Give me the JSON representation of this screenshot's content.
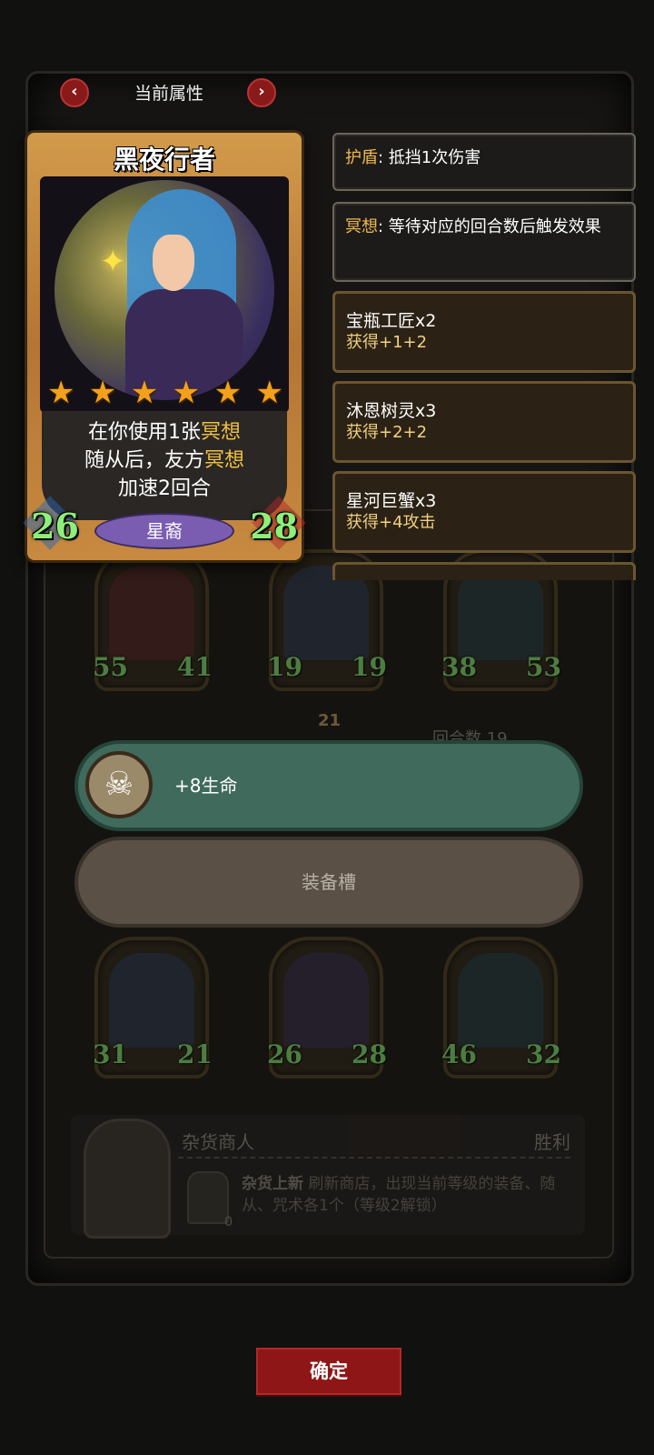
{
  "header": {
    "title": "当前属性",
    "prev_icon": "chevron-left-icon",
    "next_icon": "chevron-right-icon",
    "prev_glyph": "‹",
    "next_glyph": "›"
  },
  "card": {
    "name": "黑夜行者",
    "stars": 6,
    "desc_lines": [
      {
        "pre": "在你使用1张",
        "kw": "冥想",
        "post": ""
      },
      {
        "pre": "随从后，友方",
        "kw": "冥想",
        "post": ""
      },
      {
        "pre": "加速2回合",
        "kw": "",
        "post": ""
      }
    ],
    "attack": "26",
    "health": "28",
    "tribe": "星裔"
  },
  "keywords": [
    {
      "name": "护盾",
      "sep": ": ",
      "desc": "抵挡1次伤害"
    },
    {
      "name": "冥想",
      "sep": ": ",
      "desc": "等待对应的回合数后触发效果"
    }
  ],
  "synergies": [
    {
      "name": "宝瓶工匠x2",
      "effect": "获得+1+2"
    },
    {
      "name": "沐恩树灵x3",
      "effect": "获得+2+2"
    },
    {
      "name": "星河巨蟹x3",
      "effect": "获得+4攻击"
    }
  ],
  "board_top": [
    {
      "atk": "55",
      "hp": "41"
    },
    {
      "atk": "19",
      "hp": "19"
    },
    {
      "atk": "38",
      "hp": "53"
    }
  ],
  "board_bottom": [
    {
      "atk": "31",
      "hp": "21"
    },
    {
      "atk": "26",
      "hp": "28"
    },
    {
      "atk": "46",
      "hp": "32"
    }
  ],
  "round_info": "回合数 19",
  "round_badge": "21",
  "buff": {
    "text": "+8生命",
    "icon": "skull-icon",
    "glyph": "☠"
  },
  "equip_slot": "装备槽",
  "shop": {
    "name": "杂货商人",
    "status": "胜利",
    "desc_bold": "杂货上新",
    "desc": " 刷新商店，出现当前等级的装备、随从、咒术各1个（等级2解锁）",
    "cost": "0"
  },
  "confirm_label": "确定",
  "colors": {
    "accent_red": "#8e1616",
    "keyword_gold": "#f0b84a",
    "stat_green": "#8cf07a",
    "buff_teal": "#3f6a5c"
  }
}
